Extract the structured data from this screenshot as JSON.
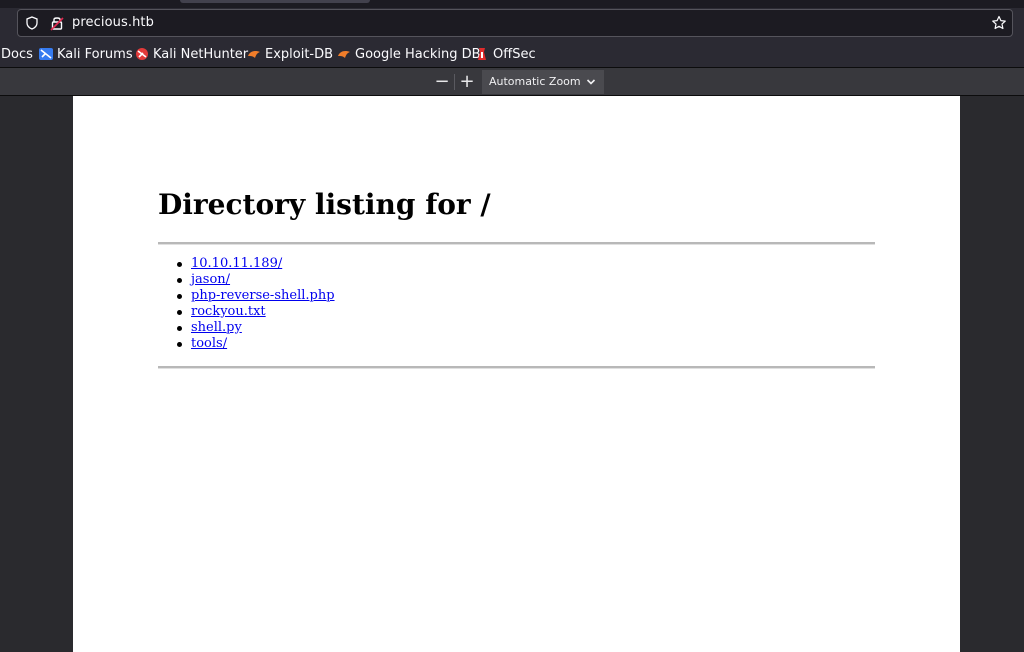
{
  "browser": {
    "url": "precious.htb",
    "bookmarks": [
      {
        "label": "Docs",
        "icon": "none"
      },
      {
        "label": "Kali Forums",
        "icon": "kali-forums-icon"
      },
      {
        "label": "Kali NetHunter",
        "icon": "kali-nethunter-icon"
      },
      {
        "label": "Exploit-DB",
        "icon": "exploit-db-icon"
      },
      {
        "label": "Google Hacking DB",
        "icon": "ghdb-icon"
      },
      {
        "label": "OffSec",
        "icon": "offsec-icon"
      }
    ]
  },
  "pdf_toolbar": {
    "zoom_out": "−",
    "zoom_in": "+",
    "zoom_level": "Automatic Zoom"
  },
  "document": {
    "title": "Directory listing for /",
    "entries": [
      "10.10.11.189/",
      "jason/",
      "php-reverse-shell.php",
      "rockyou.txt",
      "shell.py",
      "tools/"
    ]
  },
  "colors": {
    "link": "#0000ee",
    "chrome_bg": "#2b2a33",
    "viewer_bg": "#2a2a2e"
  }
}
